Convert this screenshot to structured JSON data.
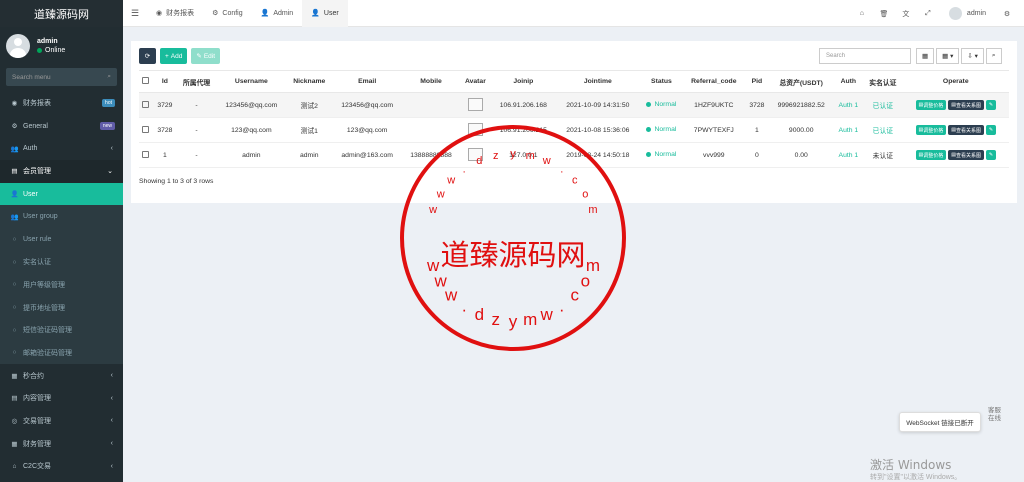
{
  "brand": "道臻源码网",
  "user": {
    "name": "admin",
    "status": "Online"
  },
  "sidebar": {
    "search_placeholder": "Search menu",
    "items": [
      {
        "label": "财务报表",
        "icon": "dashboard-icon",
        "glyph": "◉",
        "badge": "hot",
        "badge_color": "#3c8dbc"
      },
      {
        "label": "General",
        "icon": "cogs-icon",
        "glyph": "⚙",
        "badge": "new",
        "badge_color": "#605ca8"
      },
      {
        "label": "Auth",
        "icon": "group-icon",
        "glyph": "👥",
        "chev": "‹"
      },
      {
        "label": "会员管理",
        "icon": "list-icon",
        "glyph": "▤",
        "chev": "⌄"
      },
      {
        "label": "User",
        "icon": "user-icon",
        "glyph": "👤"
      },
      {
        "label": "User group",
        "icon": "users-icon",
        "glyph": "👥"
      },
      {
        "label": "User rule",
        "icon": "circle-icon",
        "glyph": "○"
      },
      {
        "label": "实名认证",
        "icon": "circle-icon",
        "glyph": "○"
      },
      {
        "label": "用户等级管理",
        "icon": "circle-icon",
        "glyph": "○"
      },
      {
        "label": "提币地址管理",
        "icon": "circle-icon",
        "glyph": "○"
      },
      {
        "label": "短信验证码管理",
        "icon": "circle-icon",
        "glyph": "○"
      },
      {
        "label": "邮箱验证码管理",
        "icon": "circle-icon",
        "glyph": "○"
      },
      {
        "label": "秒合约",
        "icon": "calendar-icon",
        "glyph": "▦",
        "chev": "‹"
      },
      {
        "label": "内容管理",
        "icon": "list-icon",
        "glyph": "▤",
        "chev": "‹"
      },
      {
        "label": "交易管理",
        "icon": "eye-icon",
        "glyph": "◎",
        "chev": "‹"
      },
      {
        "label": "财务管理",
        "icon": "table-icon",
        "glyph": "▦",
        "chev": "‹"
      },
      {
        "label": "C2C交易",
        "icon": "bank-icon",
        "glyph": "⌂",
        "chev": "‹"
      }
    ]
  },
  "topbar": {
    "tabs": [
      {
        "label": "财务报表",
        "glyph": "◉",
        "icon": "dashboard-icon"
      },
      {
        "label": "Config",
        "glyph": "⚙",
        "icon": "cog-icon"
      },
      {
        "label": "Admin",
        "glyph": "👤",
        "icon": "user-icon"
      },
      {
        "label": "User",
        "glyph": "👤",
        "icon": "user-icon"
      }
    ],
    "user_name": "admin"
  },
  "toolbar": {
    "add_label": "Add",
    "edit_label": "Edit",
    "search_placeholder": "Search"
  },
  "table": {
    "columns": [
      "Id",
      "所属代理",
      "Username",
      "Nickname",
      "Email",
      "Mobile",
      "Avatar",
      "Joinip",
      "Jointime",
      "Status",
      "Referral_code",
      "Pid",
      "总资产(USDT)",
      "Auth",
      "实名认证",
      "Operate"
    ],
    "rows": [
      {
        "id": "3729",
        "agent": "-",
        "username": "123456@qq.com",
        "nickname": "测试2",
        "email": "123456@qq.com",
        "mobile": "",
        "joinip": "106.91.206.168",
        "jointime": "2021-10-09 14:31:50",
        "status": "Normal",
        "code": "1HZF9UKTC",
        "pid": "3728",
        "assets": "9996921882.52",
        "auth": "Auth 1",
        "realname": "已认证"
      },
      {
        "id": "3728",
        "agent": "-",
        "username": "123@qq.com",
        "nickname": "测试1",
        "email": "123@qq.com",
        "mobile": "",
        "joinip": "106.91.206.215",
        "jointime": "2021-10-08 15:36:06",
        "status": "Normal",
        "code": "7PWYTEXFJ",
        "pid": "1",
        "assets": "9000.00",
        "auth": "Auth 1",
        "realname": "已认证"
      },
      {
        "id": "1",
        "agent": "-",
        "username": "admin",
        "nickname": "admin",
        "email": "admin@163.com",
        "mobile": "13888888888",
        "joinip": "127.0.0.1",
        "jointime": "2019-08-24 14:50:18",
        "status": "Normal",
        "code": "vvv999",
        "pid": "0",
        "assets": "0.00",
        "auth": "Auth 1",
        "realname": "未认证"
      }
    ],
    "op_price": "调整价格",
    "op_relation": "查看关系图"
  },
  "pager": "Showing 1 to 3 of 3 rows",
  "watermark": {
    "center": "道臻源码网",
    "top_letters": [
      "w",
      "w",
      "w",
      ".",
      "d",
      "z",
      "y",
      "m",
      "w",
      ".",
      "c",
      "o",
      "m"
    ],
    "bottom_letters": [
      "w",
      "w",
      "w",
      ".",
      "d",
      "z",
      "y",
      "m",
      "w",
      ".",
      "c",
      "o",
      "m"
    ],
    "color": "#e01010"
  },
  "ws_toast": "WebSocket 链接已断开",
  "cs_label": "客服\n在线",
  "windows": {
    "line1": "激活 Windows",
    "line2": "转到\"设置\"以激活 Windows。"
  }
}
